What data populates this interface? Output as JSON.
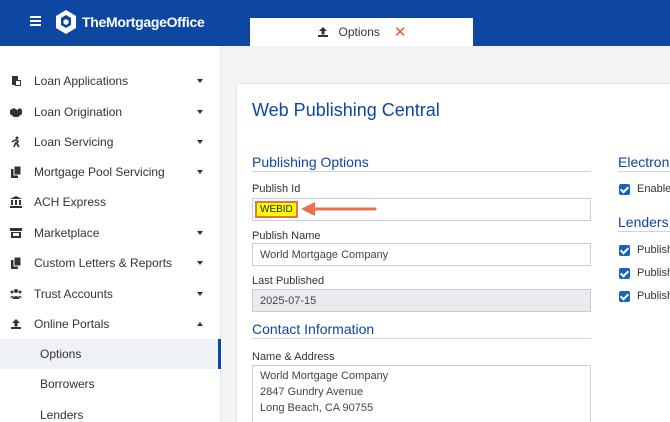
{
  "brand": {
    "name": "TheMortgageOffice"
  },
  "tab": {
    "label": "Options",
    "icon": "upload-icon",
    "close": "✕"
  },
  "sidebar": {
    "items": [
      {
        "label": "Loan Applications",
        "icon": "loan-app-icon"
      },
      {
        "label": "Loan Origination",
        "icon": "handshake-icon"
      },
      {
        "label": "Loan Servicing",
        "icon": "person-run-icon"
      },
      {
        "label": "Mortgage Pool Servicing",
        "icon": "copy-icon"
      },
      {
        "label": "ACH Express",
        "icon": "bank-icon"
      },
      {
        "label": "Marketplace",
        "icon": "store-icon"
      },
      {
        "label": "Custom Letters & Reports",
        "icon": "copy-icon"
      },
      {
        "label": "Trust Accounts",
        "icon": "users-icon"
      },
      {
        "label": "Online Portals",
        "icon": "upload-icon"
      }
    ],
    "subitems": [
      {
        "label": "Options",
        "active": true
      },
      {
        "label": "Borrowers"
      },
      {
        "label": "Lenders"
      }
    ]
  },
  "main": {
    "title": "Web Publishing Central",
    "publishing": {
      "heading": "Publishing Options",
      "publish_id_label": "Publish Id",
      "publish_id_value": "WEBID",
      "publish_name_label": "Publish Name",
      "publish_name_value": "World Mortgage Company",
      "last_published_label": "Last Published",
      "last_published_value": "2025-07-15"
    },
    "contact": {
      "heading": "Contact Information",
      "name_address_label": "Name & Address",
      "lines": [
        "World Mortgage Company",
        "2847 Gundry Avenue",
        "Long Beach, CA 90755"
      ]
    },
    "right": {
      "electronic_heading": "Electron",
      "enable_label": "Enable",
      "lenders_heading": "Lenders",
      "publish_labels": [
        "Publish",
        "Publish",
        "Publish"
      ]
    }
  },
  "colors": {
    "brand": "#0d47a1",
    "highlight": "#ffff00",
    "arrow": "#e9724c",
    "checkbox": "#1565c0"
  }
}
